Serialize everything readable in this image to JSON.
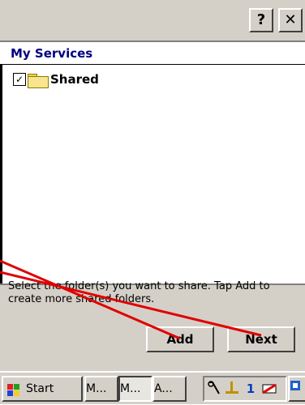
{
  "titlebar": {
    "help_label": "?",
    "close_label": "✕"
  },
  "header": {
    "title": "My Services"
  },
  "tree": {
    "items": [
      {
        "label": "Shared",
        "checked": true,
        "check_mark": "✓"
      }
    ]
  },
  "instructions": "Select the folder(s) you want to share.  Tap Add to create more shared folders.",
  "buttons": {
    "add": "Add",
    "next": "Next"
  },
  "taskbar": {
    "start": "Start",
    "tasks": [
      "M...",
      "M...",
      "A..."
    ],
    "tray_number": "1"
  },
  "colors": {
    "header_text": "#000080",
    "annotation_arrow": "#e00000",
    "chrome": "#d4d0c8"
  }
}
